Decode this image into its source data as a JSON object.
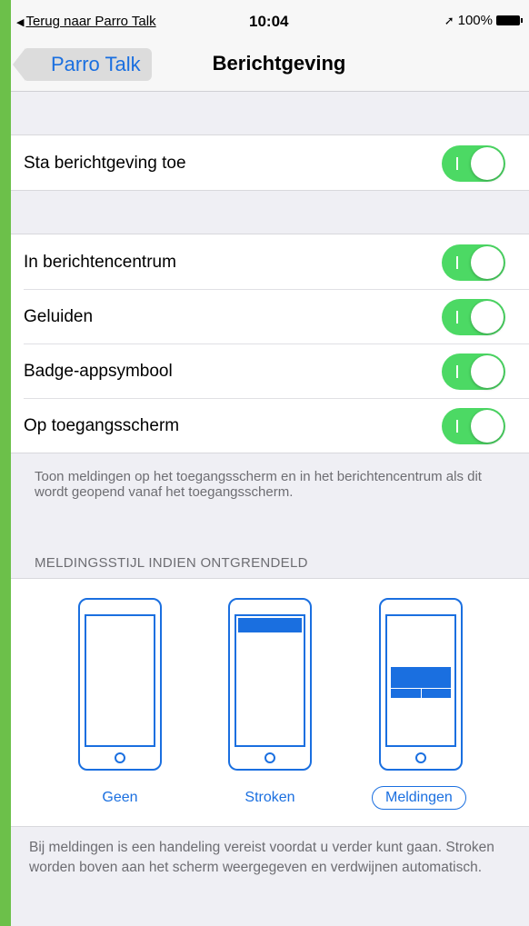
{
  "statusbar": {
    "back_text": "Terug naar Parro Talk",
    "time": "10:04",
    "battery": "100%"
  },
  "navbar": {
    "back_label": "Parro Talk",
    "title": "Berichtgeving"
  },
  "allow": {
    "label": "Sta berichtgeving toe",
    "enabled": true
  },
  "settings": [
    {
      "label": "In berichtencentrum",
      "enabled": true
    },
    {
      "label": "Geluiden",
      "enabled": true
    },
    {
      "label": "Badge-appsymbool",
      "enabled": true
    },
    {
      "label": "Op toegangsscherm",
      "enabled": true
    }
  ],
  "lockscreen_footer": "Toon meldingen op het toegangsscherm en in het berichtencentrum als dit wordt geopend vanaf het toegangsscherm.",
  "style_section_header": "MELDINGSSTIJL INDIEN ONTGRENDELD",
  "styles": [
    {
      "label": "Geen",
      "selected": false
    },
    {
      "label": "Stroken",
      "selected": false
    },
    {
      "label": "Meldingen",
      "selected": true
    }
  ],
  "style_footer": "Bij meldingen is een handeling vereist voordat u verder kunt gaan. Stroken worden boven aan het scherm weergegeven en verdwijnen automatisch.",
  "colors": {
    "accent": "#1a6fe0",
    "toggle_on": "#4cd964",
    "background_green": "#6cc04a"
  }
}
